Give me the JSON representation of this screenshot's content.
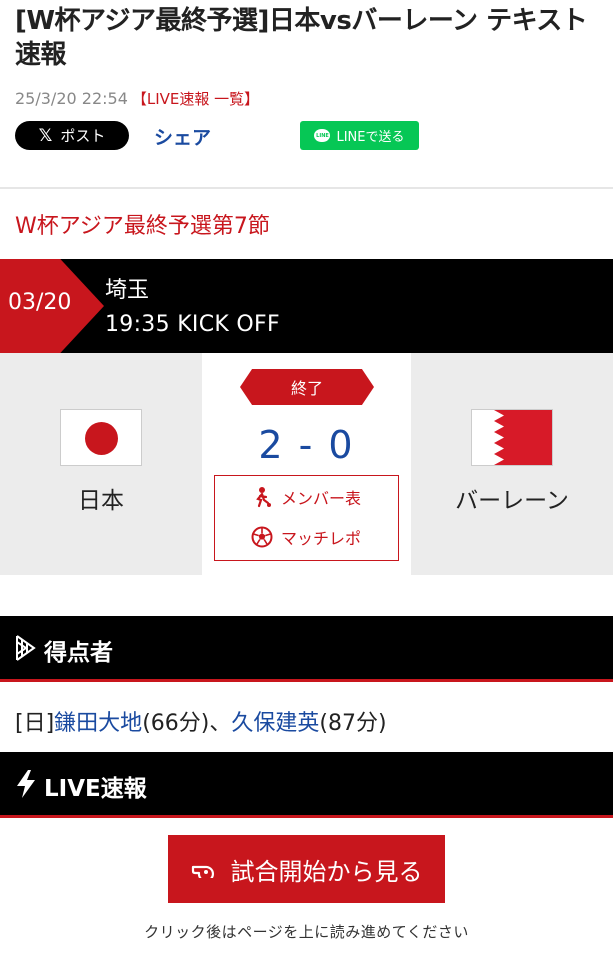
{
  "article": {
    "headline": "[W杯アジア最終予選]日本vsバーレーン テキスト速報",
    "datetime": "25/3/20 22:54",
    "live_list_link": "【LIVE速報 一覧】"
  },
  "share": {
    "x_label": "ポスト",
    "x_glyph": "𝕏",
    "share_label": "シェア",
    "line_label": "LINEで送る",
    "line_logo_text": "LINE"
  },
  "match": {
    "round": "W杯アジア最終予選第7節",
    "date": "03/20",
    "venue": "埼玉",
    "kickoff": "19:35 KICK OFF",
    "status": "終了",
    "score": "2 - 0",
    "home": {
      "name": "日本",
      "flag": "japan-flag"
    },
    "away": {
      "name": "バーレーン",
      "flag": "bahrain-flag"
    },
    "links": {
      "members": "メンバー表",
      "report": "マッチレポ"
    }
  },
  "scorers": {
    "title": "得点者",
    "team_prefix": "[日]",
    "player1": "鎌田大地",
    "minute1": "(66分)",
    "separator": "、",
    "player2": "久保建英",
    "minute2": "(87分)"
  },
  "live": {
    "title": "LIVE速報",
    "cta_label": "試合開始から見る",
    "note": "クリック後はページを上に読み進めてください"
  },
  "colors": {
    "accent_red": "#c8161d",
    "link_blue": "#1a4aa0",
    "line_green": "#06c755",
    "panel_gray": "#ececec"
  },
  "icons": [
    "x-logo-icon",
    "line-logo-icon",
    "player-icon",
    "soccer-ball-icon",
    "goal-net-icon",
    "lightning-icon",
    "whistle-icon"
  ]
}
